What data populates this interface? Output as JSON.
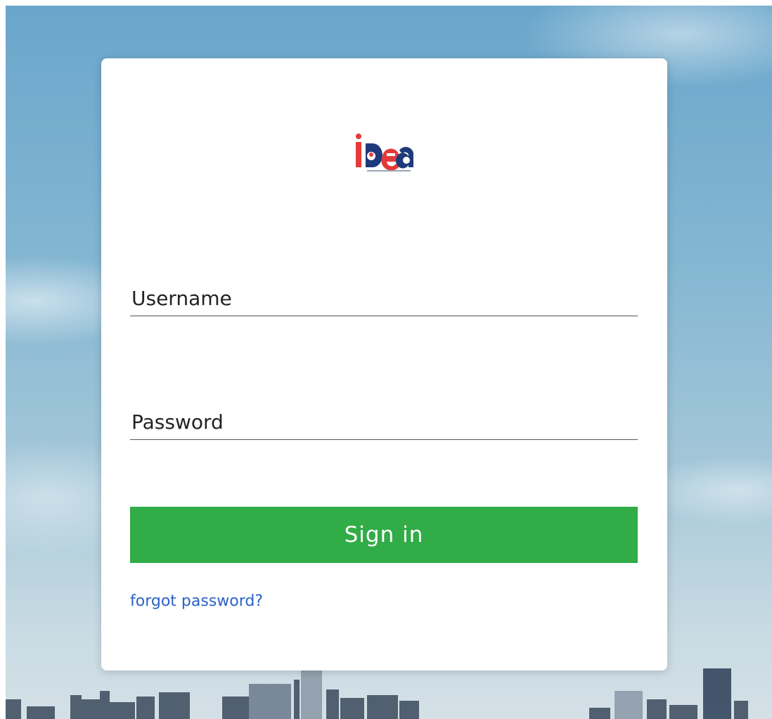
{
  "logo": {
    "text_i": "i",
    "text_d": "d",
    "text_ea": "ea",
    "brand_colors": {
      "red": "#e53a3a",
      "navy": "#1f3a7a"
    }
  },
  "form": {
    "username_placeholder": "Username",
    "password_placeholder": "Password",
    "signin_label": "Sign in",
    "forgot_label": "forgot password?"
  },
  "colors": {
    "accent_green": "#31ac47",
    "link_blue": "#2a62c9"
  }
}
